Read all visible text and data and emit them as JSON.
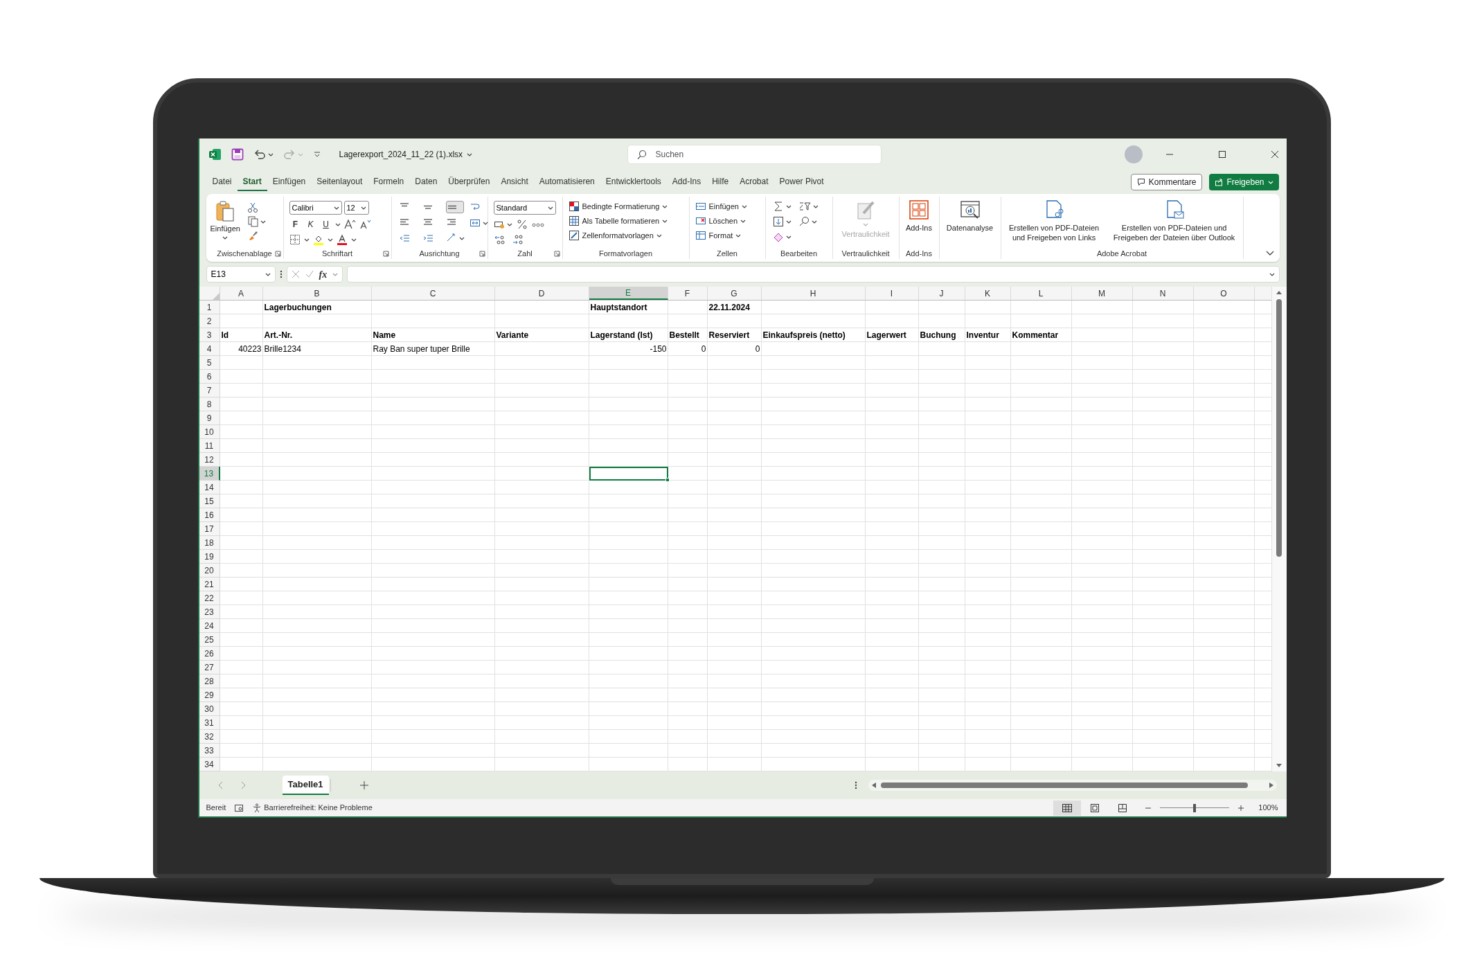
{
  "window": {
    "title": "Lagerexport_2024_11_22 (1).xlsx",
    "search": {
      "placeholder": "Suchen"
    }
  },
  "menu_tabs": [
    {
      "label": "Datei",
      "selected": false
    },
    {
      "label": "Start",
      "selected": true
    },
    {
      "label": "Einfügen",
      "selected": false
    },
    {
      "label": "Seitenlayout",
      "selected": false
    },
    {
      "label": "Formeln",
      "selected": false
    },
    {
      "label": "Daten",
      "selected": false
    },
    {
      "label": "Überprüfen",
      "selected": false
    },
    {
      "label": "Ansicht",
      "selected": false
    },
    {
      "label": "Automatisieren",
      "selected": false
    },
    {
      "label": "Entwicklertools",
      "selected": false
    },
    {
      "label": "Add-Ins",
      "selected": false
    },
    {
      "label": "Hilfe",
      "selected": false
    },
    {
      "label": "Acrobat",
      "selected": false
    },
    {
      "label": "Power Pivot",
      "selected": false
    }
  ],
  "header_buttons": [
    {
      "kind": "comments",
      "label": "Kommentare"
    },
    {
      "kind": "share",
      "label": "Freigeben"
    }
  ],
  "ribbon": [
    {
      "kind": "clipboard",
      "label": "Zwischenablage",
      "buttons": [
        {
          "label": "Einfügen"
        }
      ]
    },
    {
      "kind": "font",
      "label": "Schriftart",
      "font": "Calibri",
      "size": "12",
      "buttons": [
        {
          "label": "F"
        },
        {
          "label": "K"
        },
        {
          "label": "U"
        }
      ]
    },
    {
      "kind": "alignment",
      "label": "Ausrichtung"
    },
    {
      "kind": "number",
      "label": "Zahl",
      "format": "Standard"
    },
    {
      "kind": "styles",
      "label": "Formatvorlagen",
      "buttons": [
        {
          "label": "Bedingte Formatierung"
        },
        {
          "label": "Als Tabelle formatieren"
        },
        {
          "label": "Zellenformatvorlagen"
        }
      ]
    },
    {
      "kind": "cells",
      "label": "Zellen",
      "buttons": [
        {
          "label": "Einfügen"
        },
        {
          "label": "Löschen"
        },
        {
          "label": "Format"
        }
      ]
    },
    {
      "kind": "editing",
      "label": "Bearbeiten"
    },
    {
      "kind": "large",
      "label": "Vertraulichkeit",
      "buttons": [
        {
          "kind": "sensitivity",
          "label": "Vertraulichkeit",
          "disabled": true
        }
      ]
    },
    {
      "kind": "large",
      "label": "Add-Ins",
      "buttons": [
        {
          "kind": "addins",
          "label": "Add-Ins",
          "disabled": false
        }
      ]
    },
    {
      "kind": "large",
      "buttons": [
        {
          "kind": "analysis",
          "label": "Datenanalyse",
          "disabled": false
        }
      ]
    },
    {
      "kind": "large",
      "label": "Adobe Acrobat",
      "buttons": [
        {
          "kind": "pdf-link",
          "label": "Erstellen von PDF-Dateien und Freigeben von Links",
          "disabled": false
        },
        {
          "kind": "pdf-mail",
          "label": "Erstellen von PDF-Dateien und Freigeben der Dateien über Outlook",
          "disabled": false
        }
      ]
    }
  ],
  "formula_bar": {
    "name_box": "E13",
    "function_label": "fx"
  },
  "columns": [
    {
      "label": "A",
      "selected": false
    },
    {
      "label": "B",
      "selected": false
    },
    {
      "label": "C",
      "selected": false
    },
    {
      "label": "D",
      "selected": false
    },
    {
      "label": "E",
      "selected": true
    },
    {
      "label": "F",
      "selected": false
    },
    {
      "label": "G",
      "selected": false
    },
    {
      "label": "H",
      "selected": false
    },
    {
      "label": "I",
      "selected": false
    },
    {
      "label": "J",
      "selected": false
    },
    {
      "label": "K",
      "selected": false
    },
    {
      "label": "L",
      "selected": false
    },
    {
      "label": "M",
      "selected": false
    },
    {
      "label": "N",
      "selected": false
    },
    {
      "label": "O",
      "selected": false
    }
  ],
  "rows": [
    {
      "number": "1",
      "selected": false,
      "cells": [
        null,
        {
          "text": "Lagerbuchungen",
          "kind": "heading"
        },
        null,
        null,
        {
          "text": "Hauptstandort",
          "kind": "heading"
        },
        null,
        {
          "text": "22.11.2024",
          "kind": "heading"
        }
      ]
    },
    {
      "number": "2",
      "selected": false
    },
    {
      "number": "3",
      "selected": false,
      "cells": [
        {
          "text": "Id",
          "kind": "heading"
        },
        {
          "text": "Art.-Nr.",
          "kind": "heading"
        },
        {
          "text": "Name",
          "kind": "heading"
        },
        {
          "text": "Variante",
          "kind": "heading"
        },
        {
          "text": "Lagerstand (Ist)",
          "kind": "heading"
        },
        {
          "text": "Bestellt",
          "kind": "heading"
        },
        {
          "text": "Reserviert",
          "kind": "heading"
        },
        {
          "text": "Einkaufspreis (netto)",
          "kind": "heading"
        },
        {
          "text": "Lagerwert",
          "kind": "heading"
        },
        {
          "text": "Buchung",
          "kind": "heading"
        },
        {
          "text": "Inventur",
          "kind": "heading"
        },
        {
          "text": "Kommentar",
          "kind": "heading"
        }
      ]
    },
    {
      "number": "4",
      "selected": false,
      "cells": [
        {
          "text": "40223",
          "kind": "number"
        },
        {
          "text": "Brille1234",
          "kind": "text"
        },
        {
          "text": "Ray Ban super tuper Brille",
          "kind": "text"
        },
        null,
        {
          "text": "-150",
          "kind": "number"
        },
        {
          "text": "0",
          "kind": "number"
        },
        {
          "text": "0",
          "kind": "number"
        }
      ]
    },
    {
      "number": "5",
      "selected": false
    },
    {
      "number": "6",
      "selected": false
    },
    {
      "number": "7",
      "selected": false
    },
    {
      "number": "8",
      "selected": false
    },
    {
      "number": "9",
      "selected": false
    },
    {
      "number": "10",
      "selected": false
    },
    {
      "number": "11",
      "selected": false
    },
    {
      "number": "12",
      "selected": false
    },
    {
      "number": "13",
      "selected": true
    },
    {
      "number": "14",
      "selected": false
    },
    {
      "number": "15",
      "selected": false
    },
    {
      "number": "16",
      "selected": false
    },
    {
      "number": "17",
      "selected": false
    },
    {
      "number": "18",
      "selected": false
    },
    {
      "number": "19",
      "selected": false
    },
    {
      "number": "20",
      "selected": false
    },
    {
      "number": "21",
      "selected": false
    },
    {
      "number": "22",
      "selected": false
    },
    {
      "number": "23",
      "selected": false
    },
    {
      "number": "24",
      "selected": false
    },
    {
      "number": "25",
      "selected": false
    },
    {
      "number": "26",
      "selected": false
    },
    {
      "number": "27",
      "selected": false
    },
    {
      "number": "28",
      "selected": false
    },
    {
      "number": "29",
      "selected": false
    },
    {
      "number": "30",
      "selected": false
    },
    {
      "number": "31",
      "selected": false
    },
    {
      "number": "32",
      "selected": false
    },
    {
      "number": "33",
      "selected": false
    },
    {
      "number": "34",
      "selected": false
    }
  ],
  "sheet_tabs": [
    {
      "label": "Tabelle1",
      "selected": true
    }
  ],
  "status_bar": {
    "mode": "Bereit",
    "accessibility": "Barrierefreiheit: Keine Probleme",
    "views": [
      {
        "kind": "normal",
        "selected": true
      },
      {
        "kind": "page-layout",
        "selected": false
      },
      {
        "kind": "page-break",
        "selected": false
      }
    ],
    "zoom": {
      "level": 0.5,
      "reading": "100%"
    }
  }
}
